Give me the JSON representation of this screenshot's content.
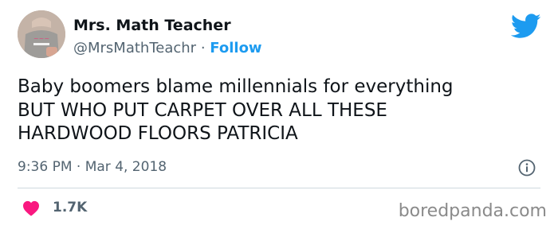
{
  "author": {
    "name": "Mrs. Math Teacher",
    "handle": "@MrsMathTeachr",
    "separator": "·",
    "follow_label": "Follow"
  },
  "tweet": {
    "text": "Baby boomers blame millennials for everything\nBUT WHO PUT CARPET OVER ALL THESE\nHARDWOOD FLOORS PATRICIA",
    "timestamp": "9:36 PM · Mar 4, 2018"
  },
  "engagement": {
    "likes": "1.7K"
  },
  "watermark": "boredpanda.com",
  "icons": {
    "avatar": "avatar",
    "twitter": "twitter-bird-icon",
    "info": "info-icon",
    "like": "heart-icon"
  },
  "colors": {
    "text": "#0f1419",
    "secondary": "#536471",
    "accent": "#1d9bf0",
    "heart": "#f91880",
    "divider": "#cfd9de",
    "watermark": "#8a8a8a"
  }
}
